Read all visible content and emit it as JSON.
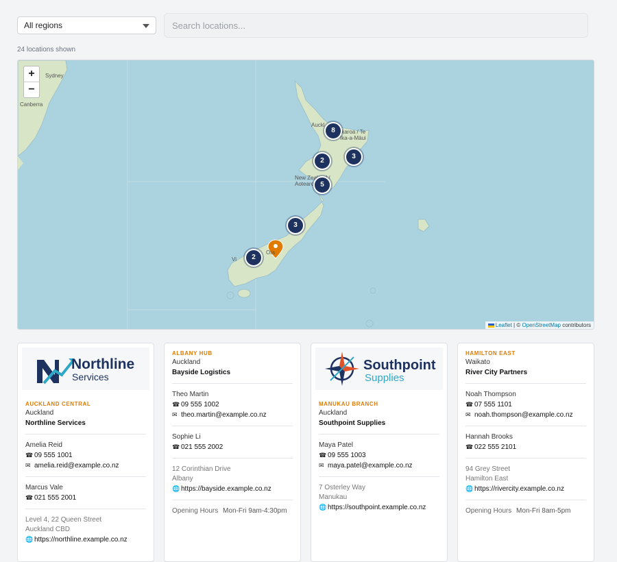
{
  "filters": {
    "region_value": "All regions",
    "search_placeholder": "Search locations..."
  },
  "count_text": "24 locations shown",
  "map": {
    "zoom_in": "+",
    "zoom_out": "−",
    "labels": {
      "sydney": "Sydney",
      "canberra": "Canberra",
      "auckland": "Auckl",
      "northland": "Ikaroa / Te Ika-a-Māui",
      "nz": "New Zealand / Aotearoa",
      "otago": "Ota",
      "west": "Vi"
    },
    "clusters": [
      "8",
      "2",
      "3",
      "5",
      "3",
      "2"
    ],
    "attribution_leaflet": "Leaflet",
    "attribution_sep": "| ©",
    "attribution_osm": "OpenStreetMap",
    "attribution_tail": "contributors",
    "colors": {
      "water": "#aad3df",
      "land": "#d8e6c7",
      "cluster": "#1e3260",
      "pin": "#e07b00"
    }
  },
  "cards": [
    {
      "logo_line1": "Northline",
      "logo_line2": "Services",
      "branch": "AUCKLAND CENTRAL",
      "region": "Auckland",
      "company": "Northline Services",
      "contacts": [
        {
          "name": "Amelia Reid",
          "phone": "09 555 1001",
          "email": "amelia.reid@example.co.nz"
        },
        {
          "name": "Marcus Vale",
          "phone": "021 555 2001"
        }
      ],
      "address1": "Level 4, 22 Queen Street",
      "address2": "Auckland CBD",
      "website": "https://northline.example.co.nz"
    },
    {
      "branch": "ALBANY HUB",
      "region": "Auckland",
      "company": "Bayside Logistics",
      "contacts": [
        {
          "name": "Theo Martin",
          "phone": "09 555 1002",
          "email": "theo.martin@example.co.nz"
        },
        {
          "name": "Sophie Li",
          "phone": "021 555 2002"
        }
      ],
      "address1": "12 Corinthian Drive",
      "address2": "Albany",
      "website": "https://bayside.example.co.nz",
      "hours_label": "Opening Hours",
      "hours_value": "Mon-Fri 9am-4:30pm"
    },
    {
      "logo_line1": "Southpoint",
      "logo_line2": "Supplies",
      "branch": "MANUKAU BRANCH",
      "region": "Auckland",
      "company": "Southpoint Supplies",
      "contacts": [
        {
          "name": "Maya Patel",
          "phone": "09 555 1003",
          "email": "maya.patel@example.co.nz"
        }
      ],
      "address1": "7 Osterley Way",
      "address2": "Manukau",
      "website": "https://southpoint.example.co.nz"
    },
    {
      "branch": "HAMILTON EAST",
      "region": "Waikato",
      "company": "River City Partners",
      "contacts": [
        {
          "name": "Noah Thompson",
          "phone": "07 555 1101",
          "email": "noah.thompson@example.co.nz"
        },
        {
          "name": "Hannah Brooks",
          "phone": "022 555 2101"
        }
      ],
      "address1": "94 Grey Street",
      "address2": "Hamilton East",
      "website": "https://rivercity.example.co.nz",
      "hours_label": "Opening Hours",
      "hours_value": "Mon-Fri 8am-5pm"
    }
  ]
}
